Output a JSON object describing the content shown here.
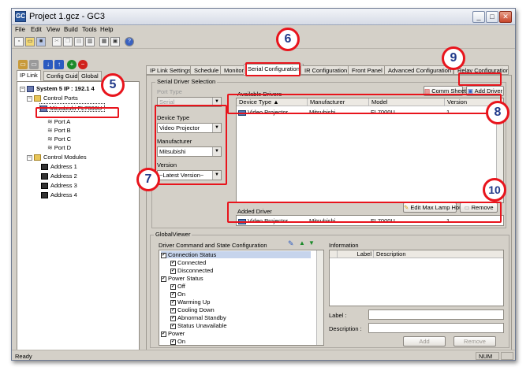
{
  "window": {
    "title": "Project 1.gcz - GC3",
    "app_icon_text": "GC"
  },
  "menu": [
    "File",
    "Edit",
    "View",
    "Build",
    "Tools",
    "Help"
  ],
  "left": {
    "tabs": [
      "IP Link",
      "Config Guide",
      "Global"
    ],
    "tree": {
      "system": "System 5 IP : 192.1",
      "system_suffix": "4",
      "control_ports": "Control Ports",
      "device": "Mitsubishi FL7000U",
      "ports": [
        "Port A",
        "Port B",
        "Port C",
        "Port D"
      ],
      "control_modules": "Control Modules",
      "addresses": [
        "Address 1",
        "Address 2",
        "Address 3",
        "Address 4"
      ]
    }
  },
  "tabs": [
    "IP Link Settings",
    "Schedule",
    "Monitor",
    "Serial Configuration",
    "IR Configuration",
    "Front Panel",
    "Advanced Configuration",
    "Relay Configuration"
  ],
  "serial": {
    "group_title": "Serial Driver Selection",
    "port_type_label": "Port Type",
    "port_type_value": "Serial",
    "device_type_label": "Device Type",
    "device_type_value": "Video Projector",
    "manufacturer_label": "Manufacturer",
    "manufacturer_value": "Mitsubishi",
    "version_label": "Version",
    "version_value": "~Latest Version~",
    "available_label": "Available Drivers",
    "comm_sheet": "Comm Sheet",
    "add_driver": "Add Driver",
    "columns": [
      "Device Type",
      "Manufacturer",
      "Model",
      "Version"
    ],
    "row": {
      "device_type": "Video Projector",
      "manufacturer": "Mitsubishi",
      "model": "FL7000U",
      "version": "1"
    },
    "added_label": "Added Driver",
    "edit_lamp": "Edit Max Lamp Hours",
    "remove": "Remove",
    "added_row": {
      "device_type": "Video Projector",
      "manufacturer": "Mitsubishi",
      "model": "FL7000U",
      "version": "1"
    }
  },
  "viewer": {
    "title": "GlobalViewer",
    "cmd_label": "Driver Command and State Configuration",
    "items": [
      {
        "text": "Connection Status",
        "indent": 0,
        "sel": true
      },
      {
        "text": "Connected",
        "indent": 1
      },
      {
        "text": "Disconnected",
        "indent": 1
      },
      {
        "text": "Power Status",
        "indent": 0
      },
      {
        "text": "Off",
        "indent": 1
      },
      {
        "text": "On",
        "indent": 1
      },
      {
        "text": "Warming Up",
        "indent": 1
      },
      {
        "text": "Cooling Down",
        "indent": 1
      },
      {
        "text": "Abnormal Standby",
        "indent": 1
      },
      {
        "text": "Status Unavailable",
        "indent": 1
      },
      {
        "text": "Power",
        "indent": 0
      },
      {
        "text": "On",
        "indent": 1
      }
    ],
    "info_label": "Information",
    "info_columns": [
      "Label",
      "Description"
    ],
    "label_field": "Label :",
    "desc_field": "Description :",
    "add": "Add",
    "remove": "Remove"
  },
  "status": {
    "text": "Ready",
    "num": "NUM"
  },
  "callouts": [
    "5",
    "6",
    "7",
    "8",
    "9",
    "10"
  ],
  "colors": {
    "highlight": "#e8141c",
    "badge_text": "#213a8a"
  }
}
